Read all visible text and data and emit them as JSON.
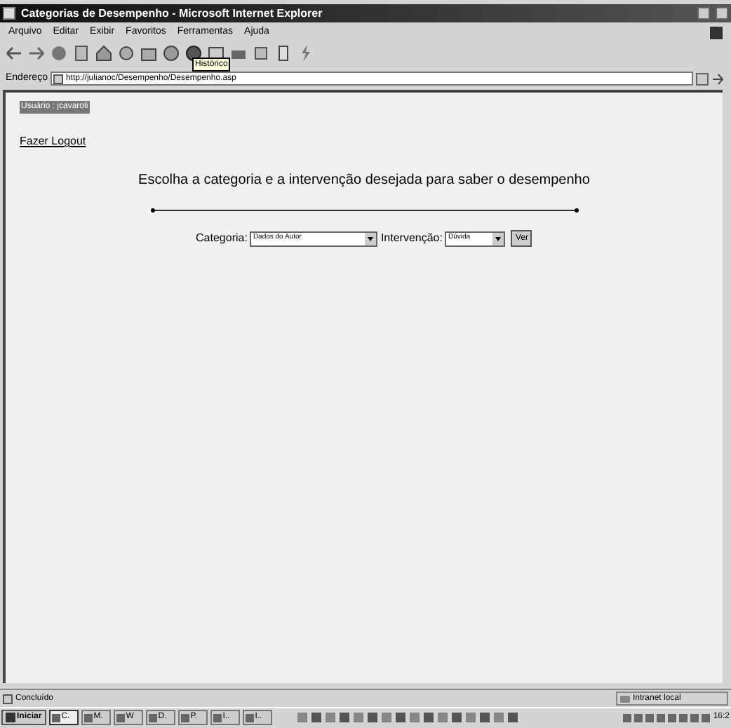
{
  "window": {
    "title": "Categorias de Desempenho - Microsoft Internet Explorer"
  },
  "menu": [
    "Arquivo",
    "Editar",
    "Exibir",
    "Favoritos",
    "Ferramentas",
    "Ajuda"
  ],
  "toolbar": {
    "tooltip": "Histórico"
  },
  "address_bar": {
    "label": "Endereço",
    "value": "http://julianoc/Desempenho/Desempenho.asp"
  },
  "page": {
    "user": "Usuário : jcavaroli",
    "logout": "Fazer Logout",
    "heading": "Escolha a categoria e a intervenção desejada para saber o desempenho",
    "form": [
      {
        "label": "Categoria:",
        "value": "Dados do Autor"
      },
      {
        "label": "Intervenção:",
        "value": "Dúvida"
      }
    ],
    "button": "Ver"
  },
  "status_bar": {
    "text": "Concluído",
    "zone": "Intranet local"
  },
  "taskbar": {
    "start": "Iniciar",
    "buttons": [
      {
        "label": "C.",
        "selected": true
      },
      {
        "label": "M.",
        "selected": false
      },
      {
        "label": "W",
        "selected": false
      },
      {
        "label": "D.",
        "selected": false
      },
      {
        "label": "P.",
        "selected": false
      },
      {
        "label": "I..",
        "selected": false
      },
      {
        "label": "I..",
        "selected": false
      }
    ],
    "clock": "16:2"
  }
}
